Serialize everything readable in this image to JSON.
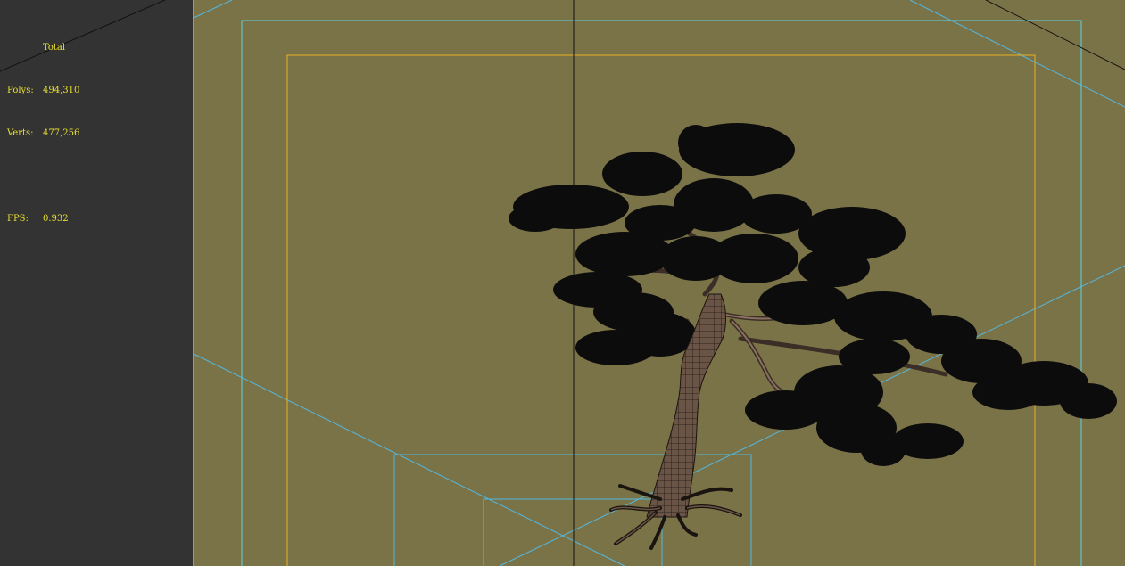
{
  "stats": {
    "header": "Total",
    "polys_label": "Polys:",
    "polys_value": "494,310",
    "verts_label": "Verts:",
    "verts_value": "477,256",
    "fps_label": "FPS:",
    "fps_value": "0.932"
  },
  "colors": {
    "panel_bg": "#333333",
    "viewport_bg": "#7b7348",
    "stats_text": "#e8e030",
    "safe_frame_outer": "#5ad4e6",
    "safe_frame_inner": "#e8b020",
    "grid_line": "#52b8e0",
    "foliage": "#0c0c0c",
    "trunk": "#6a5446",
    "wire": "#1a1410"
  },
  "viewport": {
    "object": "pine-tree-wireframe-model",
    "mode": "wireframe-shaded"
  }
}
